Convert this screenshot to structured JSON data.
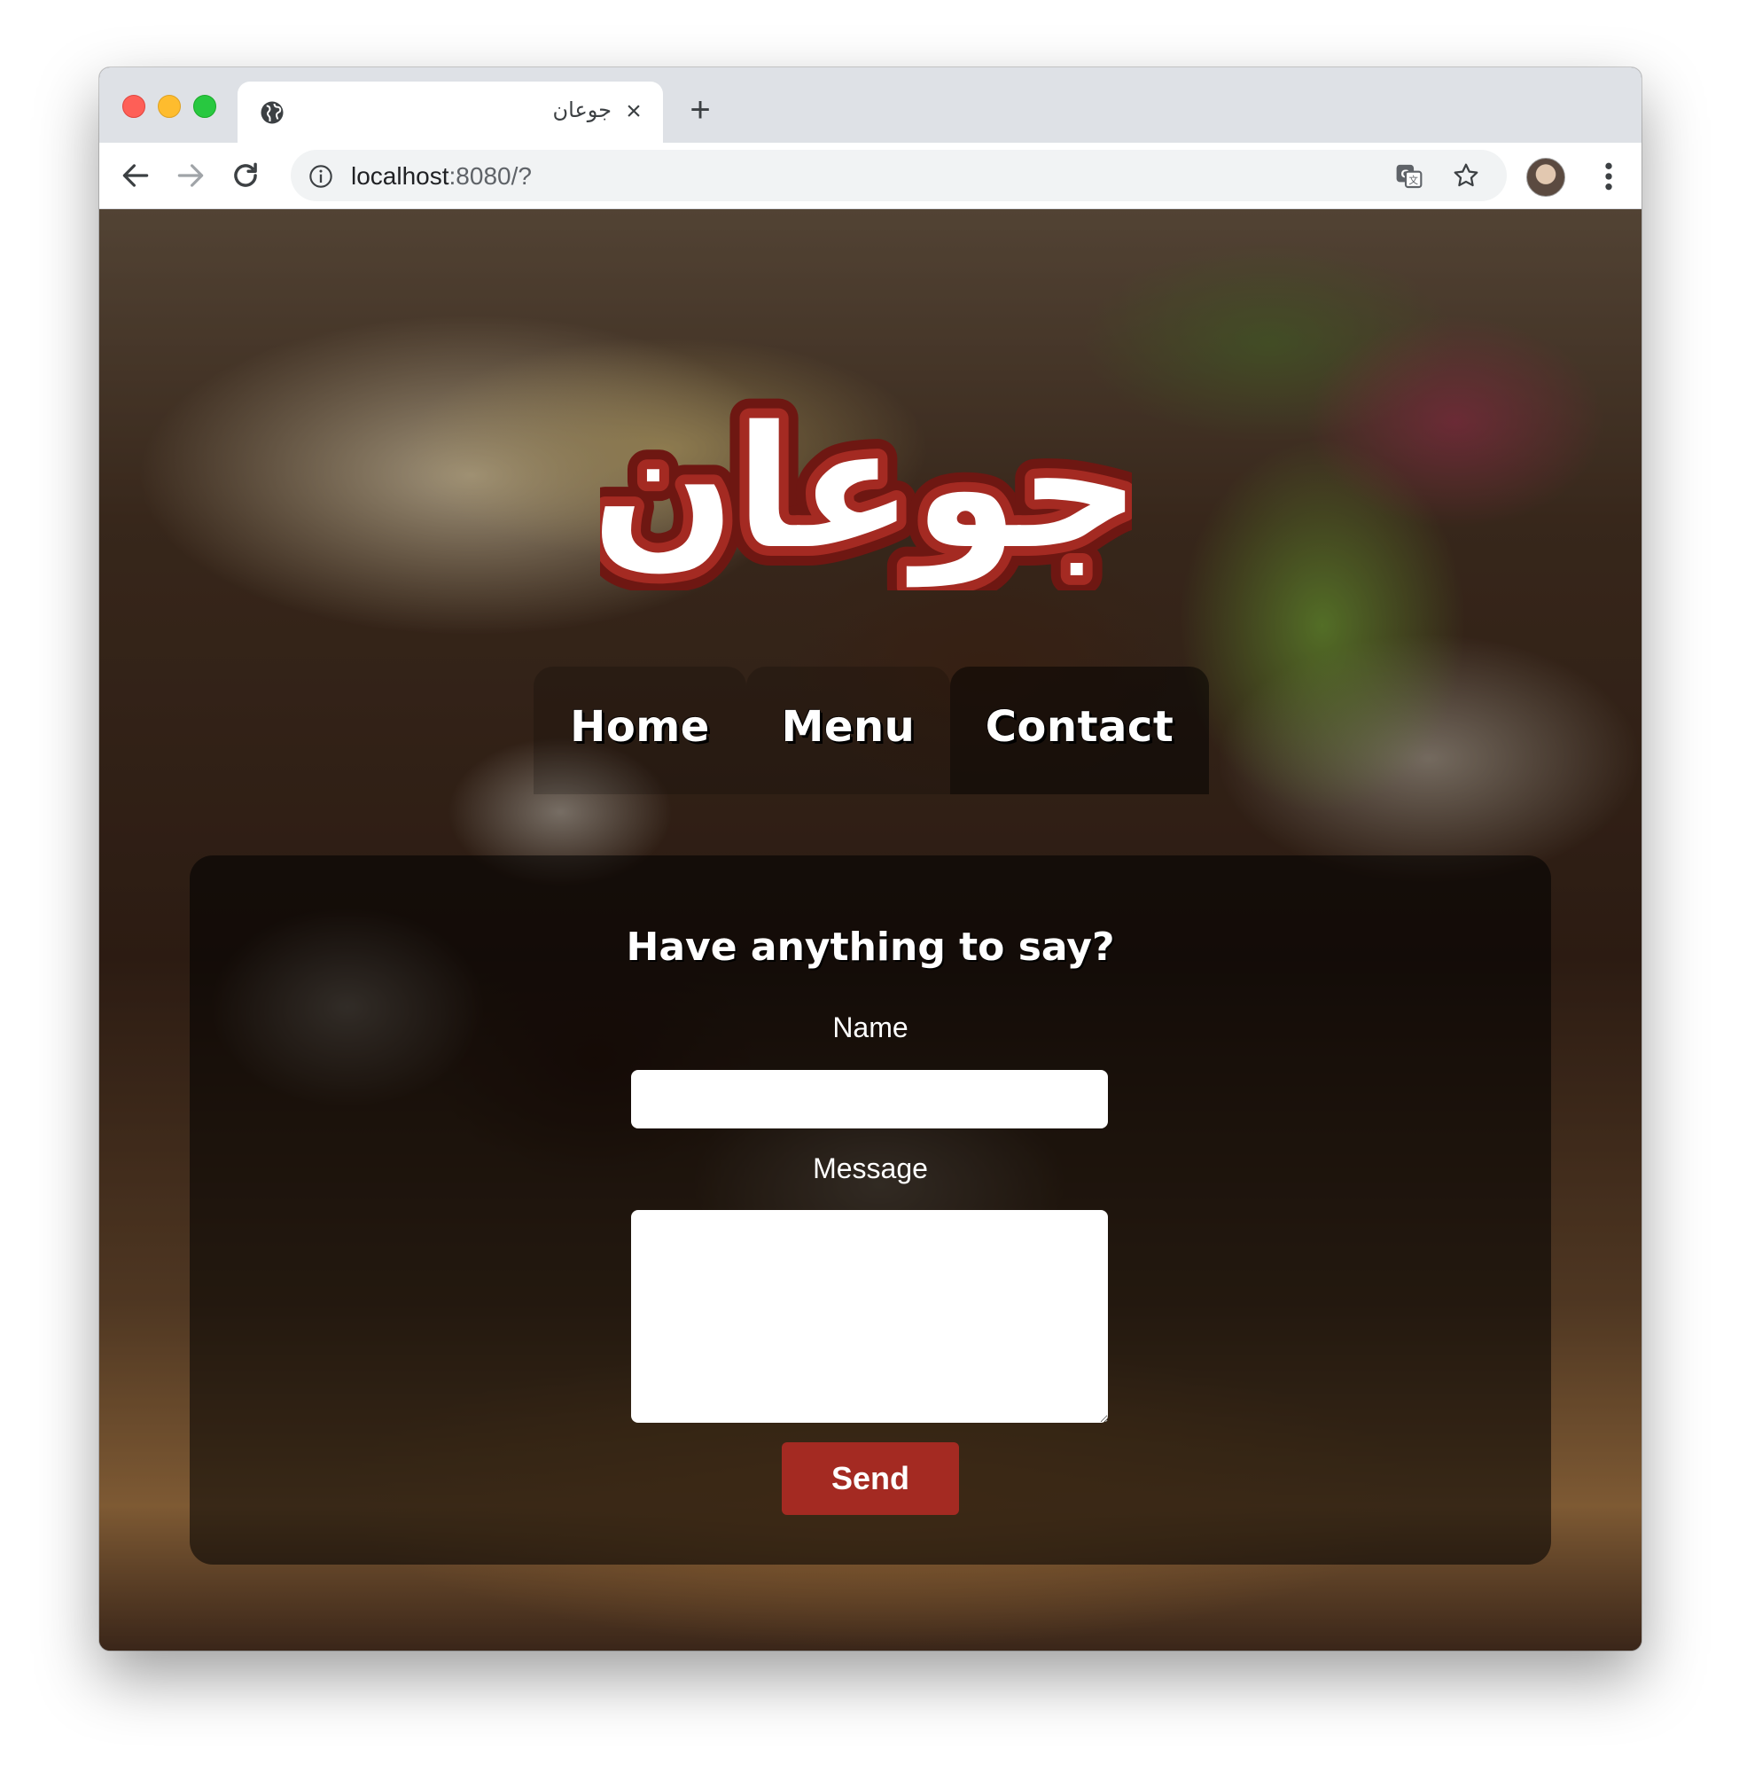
{
  "browser": {
    "tab": {
      "title": "جوعان"
    },
    "address_bar": {
      "host": "localhost",
      "rest": ":8080/?"
    }
  },
  "site": {
    "logo_text": "جوعان",
    "nav": [
      {
        "label": "Home",
        "active": false
      },
      {
        "label": "Menu",
        "active": false
      },
      {
        "label": "Contact",
        "active": true
      }
    ]
  },
  "contact_form": {
    "heading": "Have anything to say?",
    "name_label": "Name",
    "name_value": "",
    "message_label": "Message",
    "message_value": "",
    "send_label": "Send"
  },
  "colors": {
    "brand_red": "#a42a22",
    "logo_outline": "#6e1712"
  }
}
